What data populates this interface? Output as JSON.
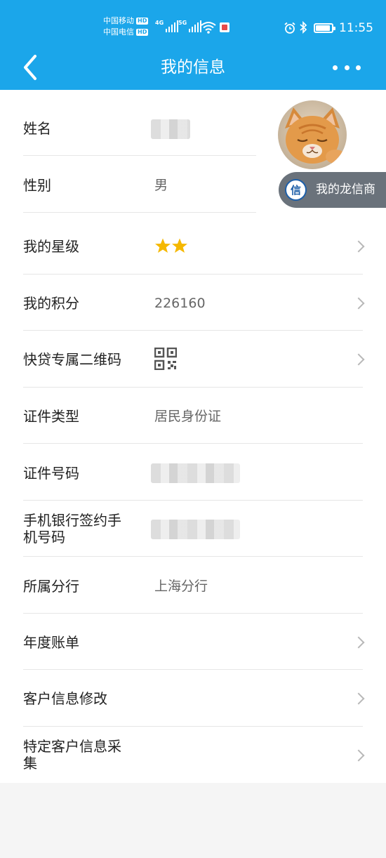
{
  "status_bar": {
    "carrier_1": "中国移动",
    "carrier_2": "中国电信",
    "hd_badge": "HD",
    "network_1": "4G",
    "network_2": "5G",
    "time": "11:55",
    "icons": [
      "signal-icon",
      "wifi-icon",
      "reader-app-icon",
      "alarm-icon",
      "bluetooth-icon",
      "battery-icon"
    ]
  },
  "header": {
    "title": "我的信息",
    "back_icon": "chevron-left-icon",
    "more_icon": "more-dots-icon"
  },
  "profile": {
    "avatar": "cat-avatar",
    "float_button_label": "我的龙信商",
    "float_button_logo_glyph": "信"
  },
  "rows": [
    {
      "label": "姓名",
      "value": "",
      "value_obscured": true
    },
    {
      "label": "性别",
      "value": "男"
    },
    {
      "label": "我的星级",
      "stars": 2
    },
    {
      "label": "我的积分",
      "value": "226160"
    },
    {
      "label": "快贷专属二维码",
      "icon": "qr-code-icon"
    },
    {
      "label": "证件类型",
      "value": "居民身份证"
    },
    {
      "label": "证件号码",
      "value": "",
      "value_obscured": true
    },
    {
      "label": "手机银行签约手机号码",
      "label_line1": "手机银行签约手",
      "label_line2": "机号码",
      "value": "",
      "value_obscured": true
    },
    {
      "label": "所属分行",
      "value": "上海分行"
    },
    {
      "label": "年度账单"
    },
    {
      "label": "客户信息修改"
    },
    {
      "label": "特定客户信息采集",
      "label_line1": "特定客户信息采",
      "label_line2": "集"
    }
  ],
  "colors": {
    "header_bg": "#1ba6ea",
    "star": "#f5b800",
    "float_bg": "#555f69"
  }
}
